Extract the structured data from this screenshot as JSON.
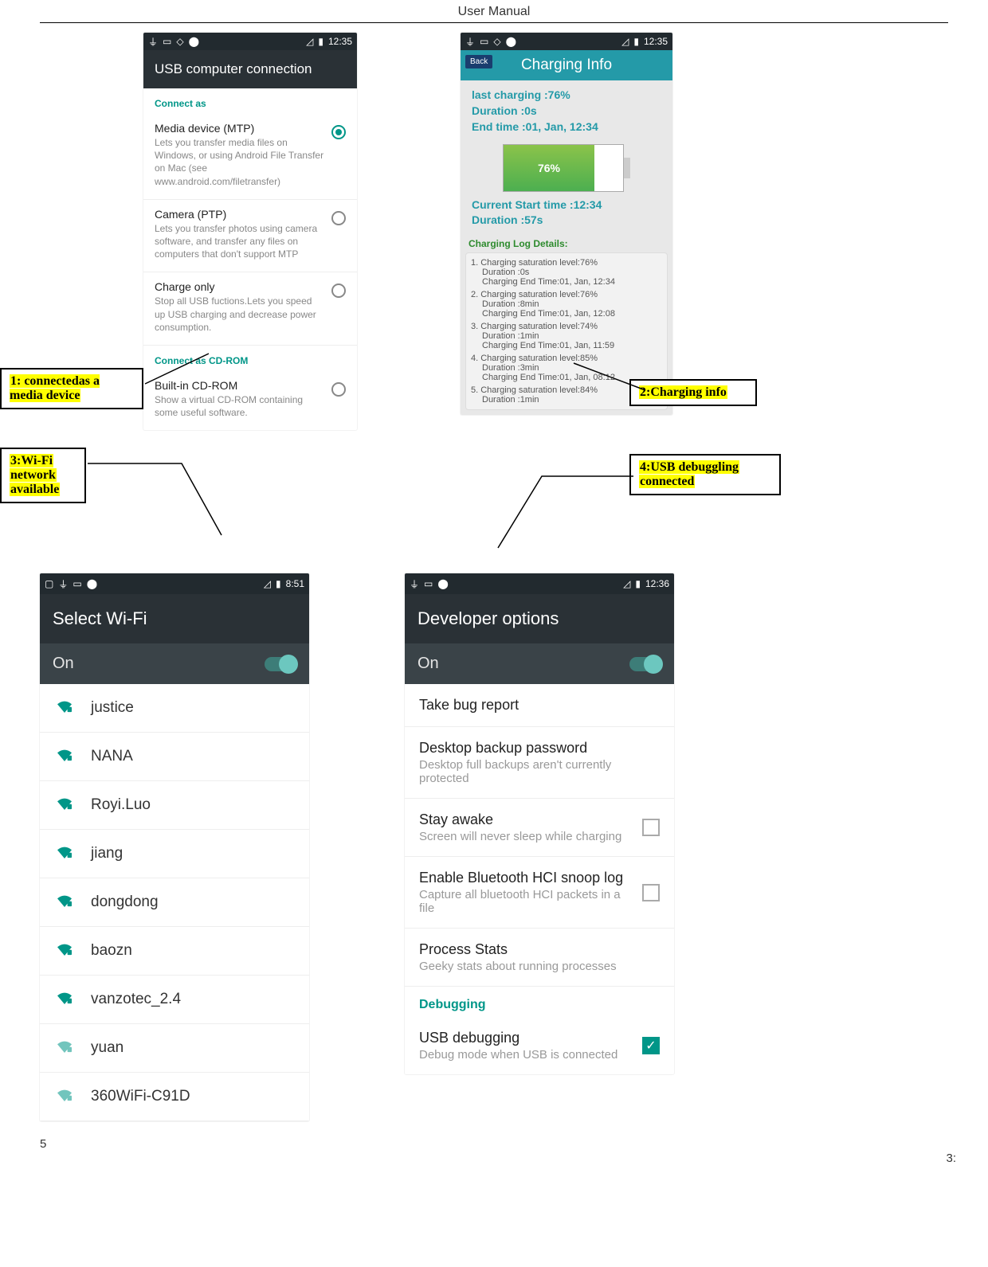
{
  "doc": {
    "title": "User  Manual",
    "page_bottom": "5",
    "page_corner": "3:"
  },
  "callouts": {
    "c1": "1:   connectedas   a media   device",
    "c2": "2:Charging info",
    "c3a": "3:Wi-Fi",
    "c3b": "network",
    "c3c": "available",
    "c4a": "4:USB   debuggling",
    "c4b": "connected"
  },
  "s1": {
    "time": "12:35",
    "title": "USB computer connection",
    "section1": "Connect as",
    "opts": [
      {
        "title": "Media device (MTP)",
        "desc": "Lets you transfer media files on Windows, or using Android File Transfer on Mac (see www.android.com/filetransfer)",
        "selected": true
      },
      {
        "title": "Camera (PTP)",
        "desc": "Lets you transfer photos using camera software, and transfer any files on computers that don't support MTP",
        "selected": false
      },
      {
        "title": "Charge only",
        "desc": "Stop all USB fuctions.Lets you speed up USB charging and decrease power consumption.",
        "selected": false
      }
    ],
    "section2": "Connect as CD-ROM",
    "opt4": {
      "title": "Built-in CD-ROM",
      "desc": "Show a virtual CD-ROM containing some useful software.",
      "selected": false
    }
  },
  "s2": {
    "time": "12:35",
    "title": "Charging Info",
    "back": "Back",
    "last_charging": "last charging :76%",
    "duration": "Duration :0s",
    "end_time": "End time :01, Jan, 12:34",
    "battery_pct": "76%",
    "current_start": "Current Start time :12:34",
    "current_duration": "Duration :57s",
    "log_title": "Charging Log Details:",
    "logs": [
      {
        "n": "1.",
        "l1": "Charging saturation level:76%",
        "l2": "Duration :0s",
        "l3": "Charging End Time:01, Jan, 12:34"
      },
      {
        "n": "2.",
        "l1": "Charging saturation level:76%",
        "l2": "Duration :8min",
        "l3": "Charging End Time:01, Jan, 12:08"
      },
      {
        "n": "3.",
        "l1": "Charging saturation level:74%",
        "l2": "Duration :1min",
        "l3": "Charging End Time:01, Jan, 11:59"
      },
      {
        "n": "4.",
        "l1": "Charging saturation level:85%",
        "l2": "Duration :3min",
        "l3": "Charging End Time:01, Jan, 08:12"
      },
      {
        "n": "5.",
        "l1": "Charging saturation level:84%",
        "l2": "Duration :1min",
        "l3": ""
      }
    ]
  },
  "s3": {
    "time": "8:51",
    "title": "Select Wi-Fi",
    "on_label": "On",
    "networks": [
      "justice",
      "NANA",
      "Royi.Luo",
      "jiang",
      "dongdong",
      "baozn",
      "vanzotec_2.4",
      "yuan",
      "360WiFi-C91D"
    ]
  },
  "s4": {
    "time": "12:36",
    "title": "Developer options",
    "on_label": "On",
    "rows": [
      {
        "t": "Take bug report",
        "d": ""
      },
      {
        "t": "Desktop backup password",
        "d": "Desktop full backups aren't currently protected"
      },
      {
        "t": "Stay awake",
        "d": "Screen will never sleep while charging",
        "chk": false
      },
      {
        "t": "Enable Bluetooth HCI snoop log",
        "d": "Capture all bluetooth HCI packets in a file",
        "chk": false
      },
      {
        "t": "Process Stats",
        "d": "Geeky stats about running processes"
      }
    ],
    "section": "Debugging",
    "usb_dbg": {
      "t": "USB debugging",
      "d": "Debug mode when USB is connected",
      "chk": true
    }
  }
}
